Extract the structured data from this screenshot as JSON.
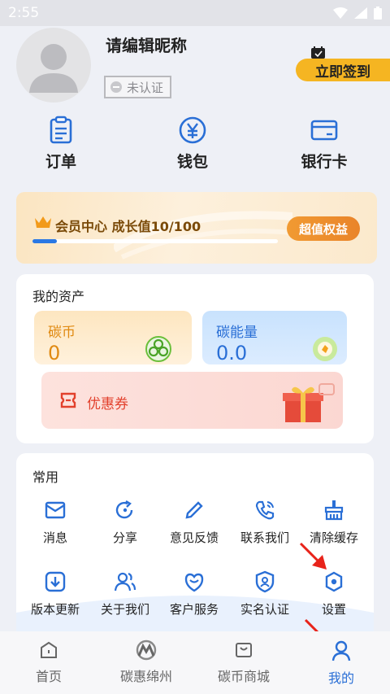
{
  "status_bar": {
    "time": "2:55"
  },
  "profile": {
    "nickname": "请编辑昵称",
    "verify_status": "未认证",
    "signin_label": "立即签到"
  },
  "quick_actions": [
    {
      "label": "订单",
      "icon": "clipboard-icon"
    },
    {
      "label": "钱包",
      "icon": "yen-coin-icon"
    },
    {
      "label": "银行卡",
      "icon": "bank-card-icon"
    }
  ],
  "member": {
    "title": "会员中心 成长值10/100",
    "progress": 0.1,
    "button_label": "超值权益"
  },
  "assets": {
    "title": "我的资产",
    "coin": {
      "label": "碳币",
      "value": "0"
    },
    "energy": {
      "label": "碳能量",
      "value": "0.0"
    },
    "coupon": {
      "label": "优惠券"
    }
  },
  "common": {
    "title": "常用",
    "items": [
      {
        "label": "消息",
        "icon": "mail-icon"
      },
      {
        "label": "分享",
        "icon": "share-icon"
      },
      {
        "label": "意见反馈",
        "icon": "edit-icon"
      },
      {
        "label": "联系我们",
        "icon": "phone-icon"
      },
      {
        "label": "清除缓存",
        "icon": "broom-icon"
      },
      {
        "label": "版本更新",
        "icon": "download-icon"
      },
      {
        "label": "关于我们",
        "icon": "users-icon"
      },
      {
        "label": "客户服务",
        "icon": "heart-shield-icon"
      },
      {
        "label": "实名认证",
        "icon": "id-shield-icon"
      },
      {
        "label": "设置",
        "icon": "settings-icon"
      }
    ]
  },
  "tabbar": {
    "items": [
      {
        "label": "首页",
        "icon": "home-icon"
      },
      {
        "label": "碳惠绵州",
        "icon": "logo-m-icon"
      },
      {
        "label": "碳币商城",
        "icon": "shop-bag-icon"
      },
      {
        "label": "我的",
        "icon": "person-icon"
      }
    ],
    "active_index": 3
  },
  "colors": {
    "accent_blue": "#2a6fd6",
    "signin_yellow": "#f5b522",
    "member_orange": "#e9842a",
    "coin_orange": "#e08a12",
    "coupon_red": "#e2402c",
    "annotation_red": "#e8231a"
  }
}
